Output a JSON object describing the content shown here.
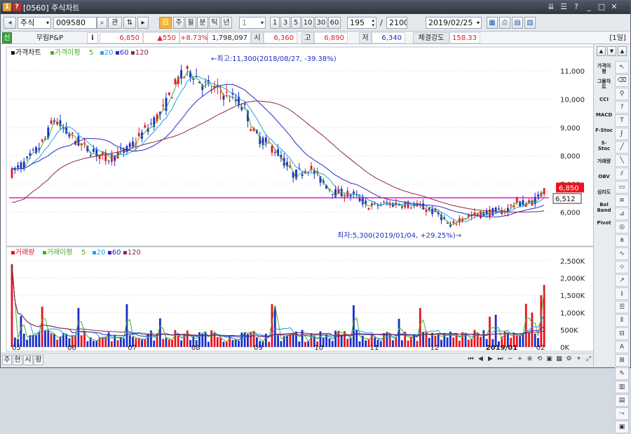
{
  "window": {
    "title": "[0560] 주식차트"
  },
  "toolbar": {
    "market": "주식",
    "code": "009580",
    "search_label": "관",
    "periods": [
      "주",
      "월",
      "분",
      "틱",
      "년"
    ],
    "interval_value": "1",
    "quick_intervals": [
      "1",
      "3",
      "5",
      "10",
      "30",
      "60"
    ],
    "count_value": "195",
    "total_value": "2100",
    "date_value": "2019/02/25",
    "separator": "/"
  },
  "quote": {
    "badge": "신",
    "name": "무림P&P",
    "info_label": "i",
    "price": "6,850",
    "change": "▲550",
    "change_pct": "+8.73%",
    "volume": "1,798,097",
    "open_label": "시",
    "open": "6,360",
    "high_label": "고",
    "high": "6,890",
    "low_label": "저",
    "low": "6,340",
    "strength_label": "체결강도",
    "strength": "158.33",
    "period_badge": "[1일]"
  },
  "price_panel": {
    "title": "가격차트",
    "ma_label": "가격이평",
    "ma_values": [
      "5",
      "20",
      "60",
      "120"
    ],
    "price_badge": "6,850",
    "line_badge": "6,512",
    "hi_annotation": "←최고:11,300(2018/08/27, -39.38%)",
    "lo_annotation": "최저:5,300(2019/01/04, +29.25%)→"
  },
  "volume_panel": {
    "title": "거래량",
    "ma_label": "거래이평",
    "ma_values": [
      "5",
      "20",
      "60",
      "120"
    ]
  },
  "x_labels": [
    "05",
    "06",
    "07",
    "08",
    "09",
    "10",
    "11",
    "12",
    "2019/01",
    "02"
  ],
  "price_ticks": [
    "11,000",
    "10,000",
    "9,000",
    "8,000",
    "7,000",
    "6,000"
  ],
  "volume_ticks": [
    "2,500K",
    "2,000K",
    "1,500K",
    "1,000K",
    "500K",
    "0K"
  ],
  "colors": {
    "up": "#e8141e",
    "down": "#1a2ec8",
    "ma5": "#4caa2a",
    "ma20": "#22a0e6",
    "ma60": "#2a2ac4",
    "ma120": "#8a2a40",
    "line": "#e000e0",
    "accent": "#d33"
  },
  "side_indicators": [
    {
      "name": "가격이평",
      "id": "ma-indicator"
    },
    {
      "name": "그물차트",
      "id": "net-indicator"
    },
    {
      "name": "CCI",
      "id": "cci-indicator"
    },
    {
      "name": "MACD",
      "id": "macd-indicator"
    },
    {
      "name": "F-Stoc",
      "id": "fstoc-indicator"
    },
    {
      "name": "S-Stoc",
      "id": "sstoc-indicator"
    },
    {
      "name": "거래량",
      "id": "volume-indicator"
    },
    {
      "name": "OBV",
      "id": "obv-indicator"
    },
    {
      "name": "심리도",
      "id": "psy-indicator"
    },
    {
      "name": "Bol Band",
      "id": "bol-indicator"
    },
    {
      "name": "Pivot",
      "id": "pivot-indicator"
    }
  ],
  "bottom_tabs": [
    "주",
    "현",
    "시",
    "황"
  ],
  "chart_data": {
    "type": "candlestick",
    "x": [
      "2018/05",
      "2018/06",
      "2018/07",
      "2018/08",
      "2018/09",
      "2018/10",
      "2018/11",
      "2018/12",
      "2019/01",
      "2019/02"
    ],
    "close_monthly": [
      7900,
      8650,
      8200,
      9400,
      10400,
      8500,
      6900,
      6200,
      5900,
      6850
    ],
    "high": 11300,
    "high_date": "2018/08/27",
    "low": 5300,
    "low_date": "2019/01/04",
    "last": 6850,
    "horizontal_line": 6512,
    "y_range": [
      5000,
      11600
    ],
    "volume_range": [
      0,
      2600000
    ],
    "series": [
      {
        "name": "5"
      },
      {
        "name": "20"
      },
      {
        "name": "60"
      },
      {
        "name": "120"
      }
    ]
  }
}
